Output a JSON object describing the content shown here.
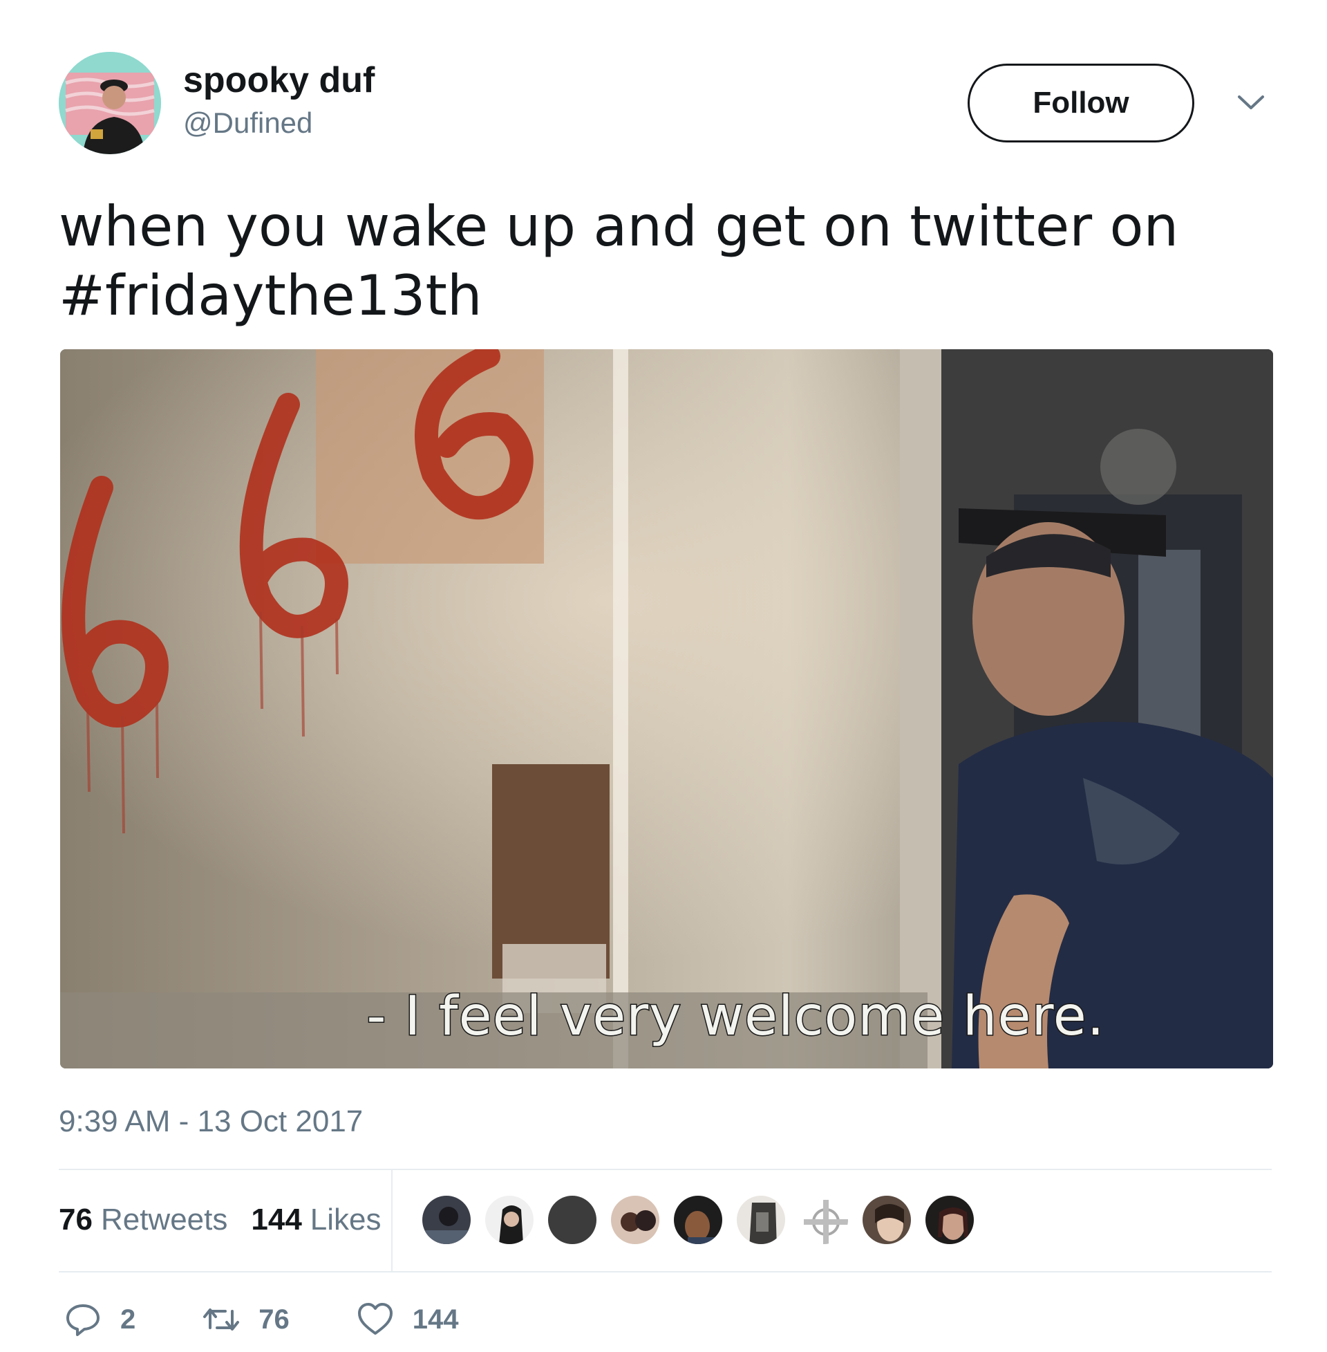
{
  "user": {
    "display_name": "spooky duf",
    "handle": "@Dufined",
    "avatar_icon": "profile-photo"
  },
  "follow_label": "Follow",
  "tweet": {
    "text_line1": "when you wake up and get on twitter on",
    "hashtag": "#fridaythe13th",
    "media_subtitle": "- I feel very welcome here.",
    "media_graffiti": "666",
    "timestamp": "9:39 AM - 13 Oct 2017"
  },
  "stats": {
    "retweets_count": "76",
    "retweets_label": "Retweets",
    "likes_count": "144",
    "likes_label": "Likes"
  },
  "actions": {
    "reply_count": "2",
    "retweet_count": "76",
    "like_count": "144"
  },
  "colors": {
    "text": "#14171a",
    "secondary": "#657786",
    "divider": "#e6ecf0",
    "avatar_bg": "#8fd9cf"
  }
}
